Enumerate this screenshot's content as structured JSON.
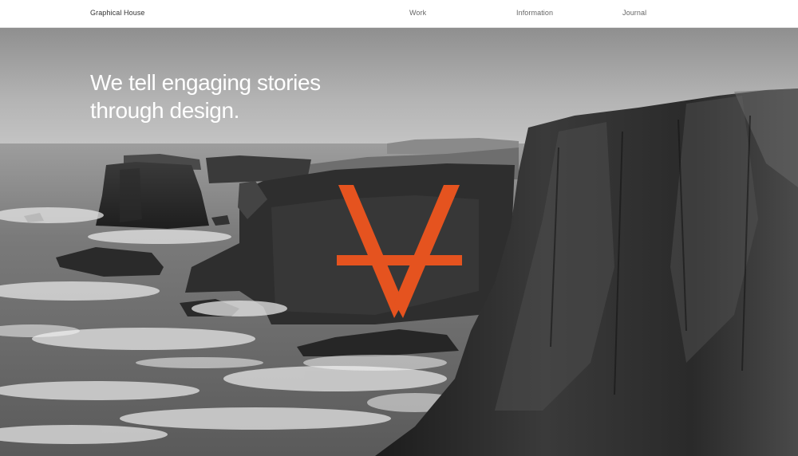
{
  "nav": {
    "brand": "Graphical House",
    "links": [
      "Work",
      "Information",
      "Journal"
    ]
  },
  "hero": {
    "headline_lines": [
      "We tell engaging stories",
      "through design."
    ],
    "logo_icon": "orange-v-mark-icon",
    "accent_color": "#e5531f"
  }
}
